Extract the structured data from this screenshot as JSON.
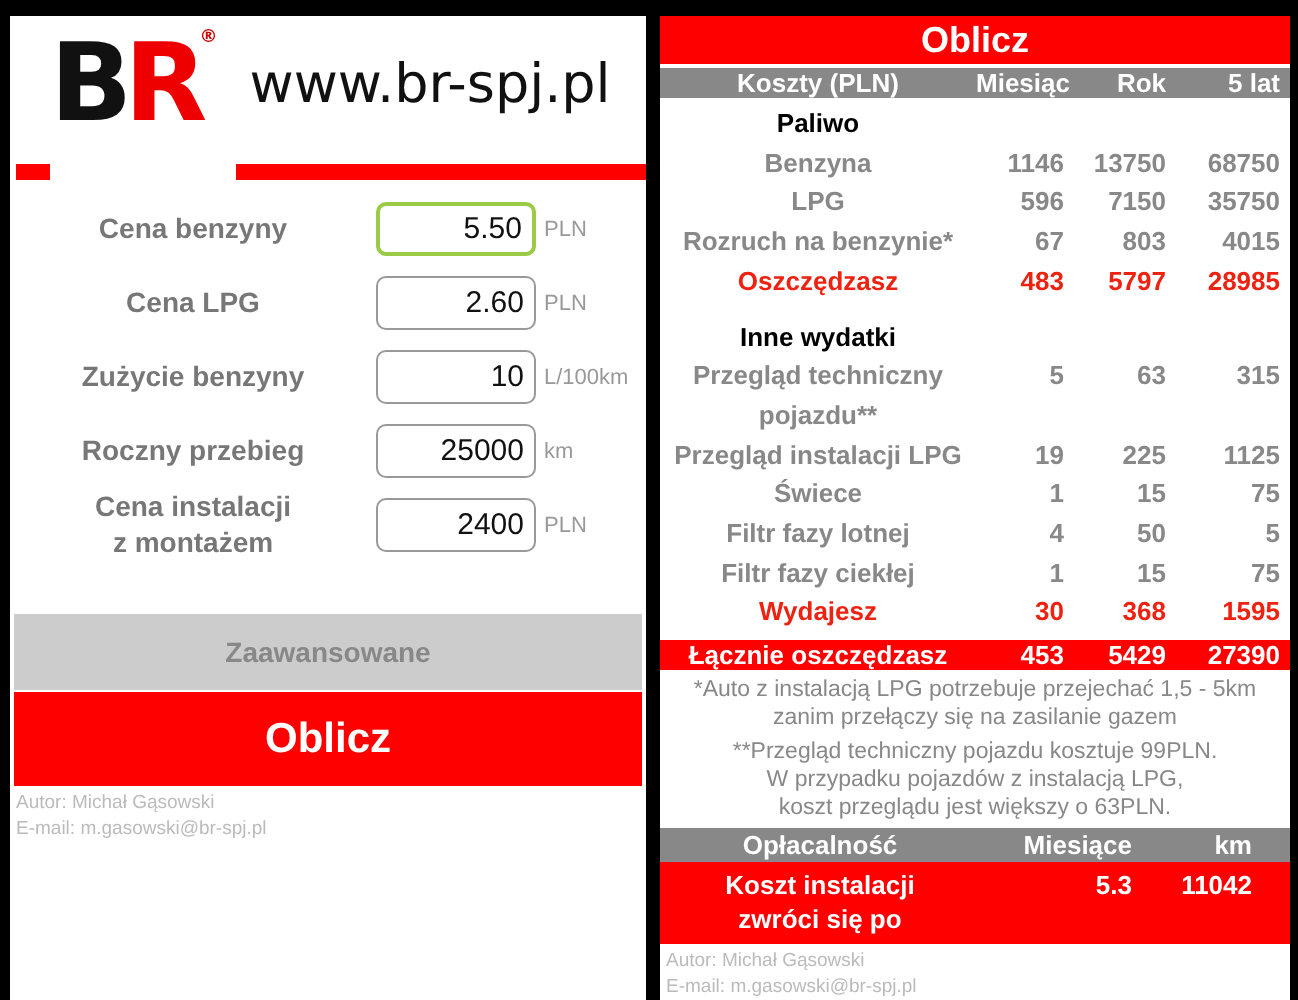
{
  "left": {
    "logo": {
      "letters": [
        "B",
        "R"
      ],
      "mark": "®",
      "url": "www.br-spj.pl"
    },
    "fields": [
      {
        "label": "Cena benzyny",
        "value": "5.50",
        "unit": "PLN",
        "focused": true
      },
      {
        "label": "Cena LPG",
        "value": "2.60",
        "unit": "PLN",
        "focused": false
      },
      {
        "label": "Zużycie benzyny",
        "value": "10",
        "unit": "L/100km",
        "focused": false
      },
      {
        "label": "Roczny przebieg",
        "value": "25000",
        "unit": "km",
        "focused": false
      },
      {
        "label": "Cena instalacji\nz montażem",
        "value": "2400",
        "unit": "PLN",
        "focused": false
      }
    ],
    "buttons": [
      {
        "label": "Zaawansowane",
        "kind": "secondary"
      },
      {
        "label": "Oblicz",
        "kind": "primary"
      }
    ],
    "footer": [
      "Autor: Michał Gąsowski",
      "E-mail: m.gasowski@br-spj.pl"
    ]
  },
  "right": {
    "title": "Oblicz",
    "columns": [
      "Koszty (PLN)",
      "Miesiąc",
      "Rok",
      "5 lat"
    ],
    "rows": [
      {
        "kind": "section",
        "label": "Paliwo"
      },
      {
        "kind": "item",
        "label": "Benzyna",
        "values": [
          "1146",
          "13750",
          "68750"
        ]
      },
      {
        "kind": "item",
        "label": "LPG",
        "values": [
          "596",
          "7150",
          "35750"
        ]
      },
      {
        "kind": "item",
        "label": "Rozruch na benzynie*",
        "values": [
          "67",
          "803",
          "4015"
        ]
      },
      {
        "kind": "total",
        "label": "Oszczędzasz",
        "values": [
          "483",
          "5797",
          "28985"
        ]
      },
      {
        "kind": "spacer"
      },
      {
        "kind": "section",
        "label": "Inne wydatki"
      },
      {
        "kind": "item",
        "label": "Przegląd techniczny pojazdu**",
        "values": [
          "5",
          "63",
          "315"
        ]
      },
      {
        "kind": "item",
        "label": "Przegląd instalacji LPG",
        "values": [
          "19",
          "225",
          "1125"
        ]
      },
      {
        "kind": "item",
        "label": "Świece",
        "values": [
          "1",
          "15",
          "75"
        ]
      },
      {
        "kind": "item",
        "label": "Filtr fazy lotnej",
        "values": [
          "4",
          "50",
          "5"
        ]
      },
      {
        "kind": "item",
        "label": "Filtr fazy ciekłej",
        "values": [
          "1",
          "15",
          "75"
        ]
      },
      {
        "kind": "total",
        "label": "Wydajesz",
        "values": [
          "30",
          "368",
          "1595"
        ]
      }
    ],
    "grand_total": {
      "label": "Łącznie oszczędzasz",
      "values": [
        "453",
        "5429",
        "27390"
      ]
    },
    "notes": [
      "*Auto z instalacją LPG potrzebuje przejechać 1,5 - 5km zanim przełączy się na zasilanie gazem",
      "**Przegląd techniczny pojazdu kosztuje 99PLN.\nW przypadku pojazdów z instalacją LPG,\nkoszt przeglądu jest większy o 63PLN."
    ],
    "payback": {
      "columns": [
        "Opłacalność",
        "Miesiące",
        "km"
      ],
      "label": "Koszt instalacji\nzwróci się po",
      "values": [
        "5.3",
        "11042"
      ]
    },
    "footer": [
      "Autor: Michał Gąsowski",
      "E-mail: m.gasowski@br-spj.pl"
    ]
  }
}
